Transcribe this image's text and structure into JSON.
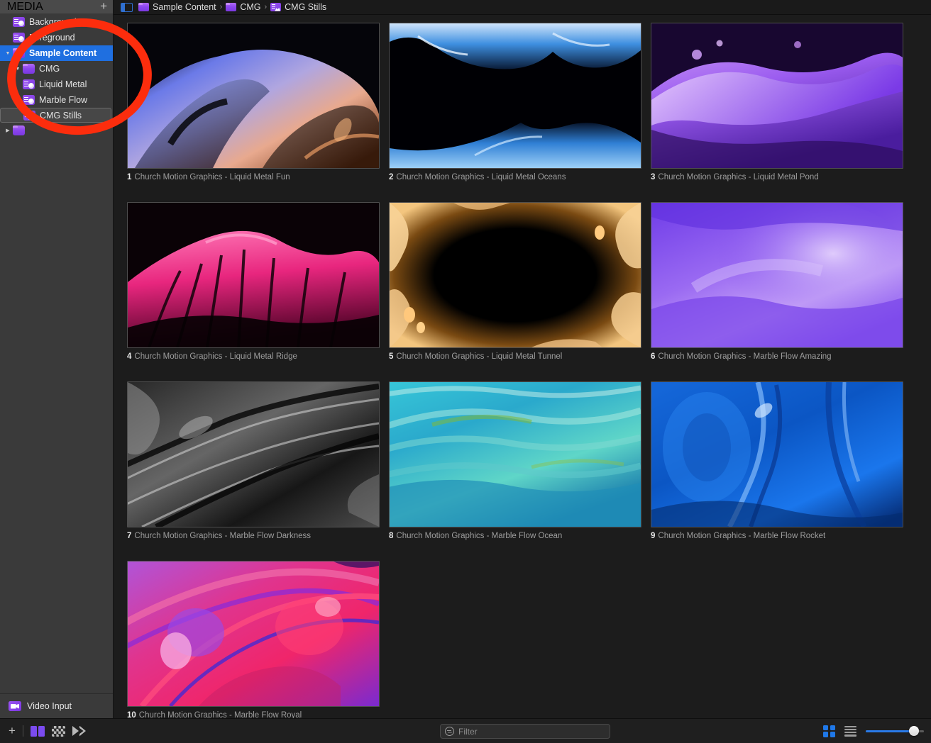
{
  "app": {
    "accent_blue": "#1f6fe0",
    "accent_purple": "#7b3ce0",
    "annotation_color": "#fc2d0d",
    "background": "#1c1c1c"
  },
  "sidebar": {
    "header_title": "MEDIA",
    "add_label": "+",
    "items": [
      {
        "label": "Backgrounds",
        "icon": "media-playlist-icon",
        "indent": 0,
        "disclosure": "none",
        "state": "normal"
      },
      {
        "label": "Foreground",
        "icon": "media-playlist-icon",
        "indent": 0,
        "disclosure": "none",
        "state": "normal"
      },
      {
        "label": "Sample Content",
        "icon": "folder-icon",
        "indent": 0,
        "disclosure": "down",
        "state": "selected"
      },
      {
        "label": "CMG",
        "icon": "folder-icon",
        "indent": 1,
        "disclosure": "down",
        "state": "normal"
      },
      {
        "label": "Liquid Metal",
        "icon": "media-playlist-icon",
        "indent": 2,
        "disclosure": "none",
        "state": "normal"
      },
      {
        "label": "Marble Flow",
        "icon": "media-playlist-icon",
        "indent": 2,
        "disclosure": "none",
        "state": "normal"
      },
      {
        "label": "CMG Stills",
        "icon": "media-image-icon",
        "indent": 2,
        "disclosure": "none",
        "state": "outlined"
      },
      {
        "label": "",
        "icon": "folder-icon",
        "indent": 0,
        "disclosure": "right",
        "state": "normal"
      }
    ],
    "footer": {
      "label": "Video Input",
      "icon": "video-camera-icon"
    }
  },
  "breadcrumb": {
    "panel_toggle_icon": "sidebar-toggle-icon",
    "separator": "›",
    "crumbs": [
      {
        "label": "Sample Content",
        "icon": "folder-icon"
      },
      {
        "label": "CMG",
        "icon": "folder-icon"
      },
      {
        "label": "CMG Stills",
        "icon": "media-image-icon"
      }
    ]
  },
  "grid": {
    "items": [
      {
        "index": "1",
        "title": "Church Motion Graphics - Liquid Metal Fun",
        "art": "liquid-metal-fun"
      },
      {
        "index": "2",
        "title": "Church Motion Graphics - Liquid Metal Oceans",
        "art": "liquid-metal-oceans"
      },
      {
        "index": "3",
        "title": "Church Motion Graphics - Liquid Metal Pond",
        "art": "liquid-metal-pond"
      },
      {
        "index": "4",
        "title": "Church Motion Graphics - Liquid Metal Ridge",
        "art": "liquid-metal-ridge"
      },
      {
        "index": "5",
        "title": "Church Motion Graphics - Liquid Metal Tunnel",
        "art": "liquid-metal-tunnel"
      },
      {
        "index": "6",
        "title": "Church Motion Graphics - Marble Flow Amazing",
        "art": "marble-flow-amazing"
      },
      {
        "index": "7",
        "title": "Church Motion Graphics - Marble Flow Darkness",
        "art": "marble-flow-darkness"
      },
      {
        "index": "8",
        "title": "Church Motion Graphics - Marble Flow Ocean",
        "art": "marble-flow-ocean"
      },
      {
        "index": "9",
        "title": "Church Motion Graphics - Marble Flow Rocket",
        "art": "marble-flow-rocket"
      },
      {
        "index": "10",
        "title": "Church Motion Graphics - Marble Flow Royal",
        "art": "marble-flow-royal"
      }
    ]
  },
  "toolbar": {
    "add_label": "+",
    "icons": [
      {
        "name": "split-panes-icon",
        "state": "active"
      },
      {
        "name": "transparency-icon",
        "state": "normal"
      },
      {
        "name": "fast-forward-icon",
        "state": "normal"
      }
    ],
    "filter": {
      "placeholder": "Filter",
      "value": "",
      "icon": "filter-icon"
    },
    "view_grid_icon": "grid-view-icon",
    "view_list_icon": "list-view-icon",
    "zoom_slider": {
      "value": 84,
      "min": 0,
      "max": 100
    }
  }
}
